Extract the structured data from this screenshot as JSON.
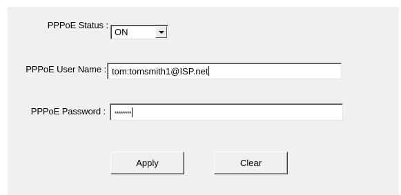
{
  "form": {
    "status_label": "PPPoE Status :",
    "status_value": "ON",
    "username_label": "PPPoE User Name :",
    "username_value": "tom:tomsmith1@ISP.net",
    "password_label": "PPPoE Password :",
    "password_value": "********"
  },
  "buttons": {
    "apply_label": "Apply",
    "clear_label": "Clear"
  },
  "colors": {
    "panel_background": "#f0f0f0",
    "page_background": "#ffffff"
  }
}
